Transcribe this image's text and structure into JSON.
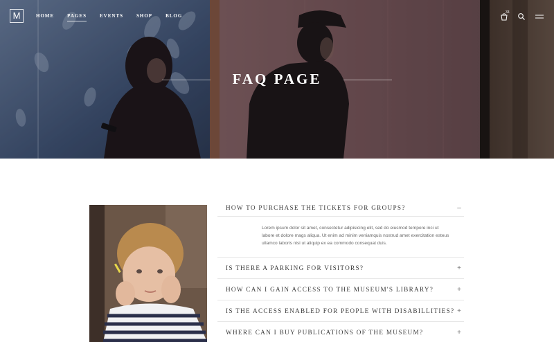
{
  "header": {
    "logo_text": "M",
    "nav": [
      {
        "label": "HOME",
        "active": false
      },
      {
        "label": "PAGES",
        "active": true
      },
      {
        "label": "EVENTS",
        "active": false
      },
      {
        "label": "SHOP",
        "active": false
      },
      {
        "label": "BLOG",
        "active": false
      }
    ],
    "cart_count": "33",
    "icons": [
      "cart-icon",
      "search-icon",
      "menu-icon"
    ]
  },
  "hero": {
    "title": "FAQ PAGE"
  },
  "faq": {
    "items": [
      {
        "question": "HOW TO PURCHASE THE TICKETS FOR GROUPS?",
        "toggle": "–",
        "expanded": true,
        "answer": "Lorem ipsum dolor sit amet, consectetur adipisicing elit, sed do eiusmod tempore inci ut labore et dolore mags aliqua. Ut enim ad minim veniamquis nostrud amet exercitation esteus ullamco laboris nisi ut aliquip ex ea commodo consequat duis."
      },
      {
        "question": "IS THERE A PARKING FOR VISITORS?",
        "toggle": "+",
        "expanded": false
      },
      {
        "question": "HOW CAN I GAIN ACCESS TO THE MUSEUM'S LIBRARY?",
        "toggle": "+",
        "expanded": false
      },
      {
        "question": "IS THE ACCESS ENABLED FOR PEOPLE WITH DISABILLITIES?",
        "toggle": "+",
        "expanded": false
      },
      {
        "question": "WHERE CAN I BUY PUBLICATIONS OF THE MUSEUM?",
        "toggle": "+",
        "expanded": false
      }
    ]
  },
  "colors": {
    "hero_dark": "#2b1f22",
    "accent_line": "#e6e6e6",
    "text": "#3a3a3a"
  }
}
